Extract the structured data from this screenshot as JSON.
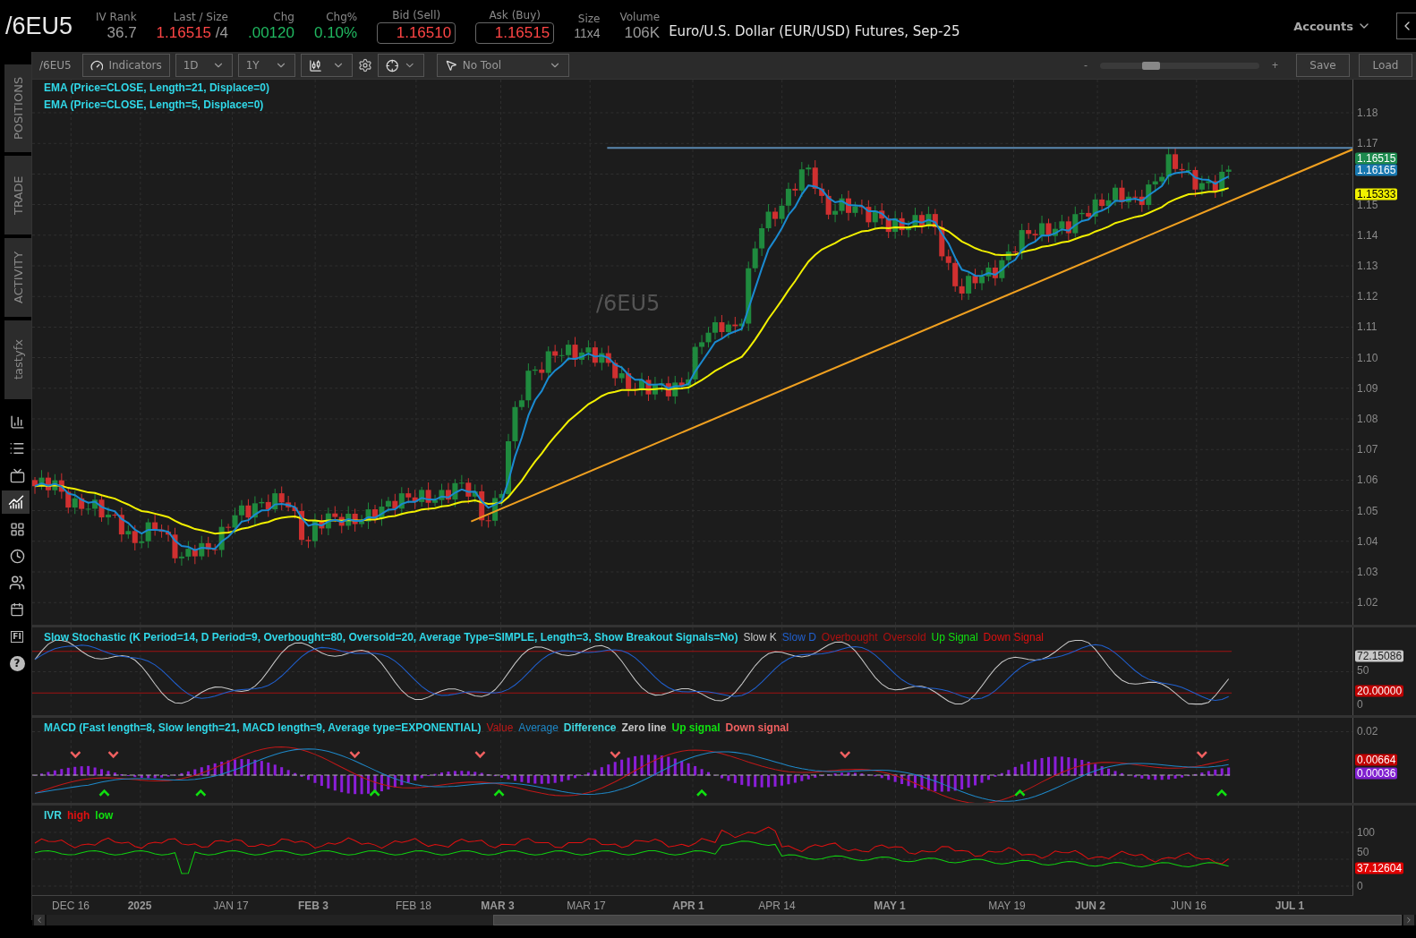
{
  "header": {
    "symbol": "/6EU5",
    "stats": [
      {
        "label": "IV Rank",
        "value": "36.7",
        "color": "#9a9a9a",
        "kind": "plain"
      },
      {
        "label": "Last / Size",
        "value": "1.16515",
        "extra": "/4",
        "color": "#ff4545",
        "kind": "plain"
      },
      {
        "label": "Chg",
        "value": ".00120",
        "color": "#20b860",
        "kind": "plain"
      },
      {
        "label": "Chg%",
        "value": "0.10%",
        "color": "#20b860",
        "kind": "plain"
      },
      {
        "label": "Bid (Sell)",
        "value": "1.16510",
        "color": "#ff4545",
        "kind": "boxed"
      },
      {
        "label": "Ask (Buy)",
        "value": "1.16515",
        "color": "#ff4545",
        "kind": "boxed"
      },
      {
        "label": "Size",
        "value": "11x4",
        "color": "#9a9a9a",
        "kind": "small"
      },
      {
        "label": "Volume",
        "value": "106K",
        "color": "#9a9a9a",
        "kind": "plain"
      }
    ],
    "description": "Euro/U.S. Dollar (EUR/USD) Futures, Sep-25",
    "accounts": "Accounts"
  },
  "sidebar": {
    "tabs": [
      "POSITIONS",
      "TRADE",
      "ACTIVITY",
      "tastyfx"
    ],
    "tools": [
      {
        "kind": "report",
        "selected": false
      },
      {
        "kind": "list",
        "selected": false
      },
      {
        "kind": "tv",
        "selected": false
      },
      {
        "kind": "chart",
        "selected": true
      },
      {
        "kind": "grid",
        "selected": false
      },
      {
        "kind": "clock",
        "selected": false
      },
      {
        "kind": "people",
        "selected": false
      },
      {
        "kind": "calendar",
        "selected": false
      },
      {
        "kind": "text",
        "label": "FI",
        "selected": false
      },
      {
        "kind": "help",
        "label": "?",
        "selected": false
      }
    ]
  },
  "toolbar": {
    "symbol": "/6EU5",
    "indicators": "Indicators",
    "aggregation": "1D",
    "range": "1Y",
    "drawing_tool": "No Tool",
    "zoom_out": "-",
    "zoom_in": "+",
    "zoom": {
      "level": 0.3
    },
    "save": "Save",
    "load": "Load"
  },
  "price_panel": {
    "studies": [
      "EMA (Price=CLOSE, Length=21, Displace=0)",
      "EMA (Price=CLOSE, Length=5, Displace=0)"
    ],
    "watermark": "/6EU5",
    "y_labels": [
      "1.18",
      "1.17",
      "1.15",
      "1.14",
      "1.13",
      "1.12",
      "1.11",
      "1.10",
      "1.09",
      "1.08",
      "1.07",
      "1.06",
      "1.05",
      "1.04",
      "1.03",
      "1.02"
    ],
    "badges": [
      {
        "value": "1.16515",
        "color": "#1d8a4e"
      },
      {
        "value": "1.16165",
        "color": "#1878b0"
      },
      {
        "value": "1.15333",
        "color": "#f0f000"
      }
    ]
  },
  "stochastic": {
    "title": "Slow Stochastic (K Period=14, D Period=9, Overbought=80, Oversold=20, Average Type=SIMPLE, Length=3, Show Breakout Signals=No)",
    "legend": [
      {
        "label": "Slow K",
        "color": "#c8c8c8"
      },
      {
        "label": "Slow D",
        "color": "#2060d0"
      },
      {
        "label": "Overbought",
        "color": "#b01010"
      },
      {
        "label": "Oversold",
        "color": "#b01010"
      },
      {
        "label": "Up Signal",
        "color": "#10e010"
      },
      {
        "label": "Down Signal",
        "color": "#e01010"
      }
    ],
    "y_labels": [
      "50",
      "0"
    ],
    "badges": [
      {
        "value": "72.15086",
        "color": "#c8c8c8"
      },
      {
        "value": "20.00000",
        "color": "#c00000"
      }
    ]
  },
  "macd": {
    "title": "MACD (Fast length=8, Slow length=21, MACD length=9, Average type=EXPONENTIAL)",
    "legend": [
      {
        "label": "Value",
        "color": "#c01818"
      },
      {
        "label": "Average",
        "color": "#1e88c8"
      },
      {
        "label": "Difference",
        "color": "#40d8e0"
      },
      {
        "label": "Zero line",
        "color": "#c8c8c8"
      },
      {
        "label": "Up signal",
        "color": "#10e010"
      },
      {
        "label": "Down signal",
        "color": "#f06060"
      }
    ],
    "y_labels": [
      "0.02"
    ],
    "badges": [
      {
        "value": "0.00664",
        "color": "#c00000"
      },
      {
        "value": "0.00036",
        "color": "#8020d0"
      }
    ]
  },
  "ivr": {
    "legend": [
      {
        "label": "IVR",
        "color": "#40d8e0"
      },
      {
        "label": "high",
        "color": "#e01010"
      },
      {
        "label": "low",
        "color": "#10e010"
      }
    ],
    "y_labels": [
      "100",
      "50",
      "0"
    ],
    "badges": [
      {
        "value": "37.12604",
        "color": "#e00000"
      }
    ]
  },
  "x_axis": [
    {
      "label": "DEC 16",
      "bold": false
    },
    {
      "label": "2025",
      "bold": true
    },
    {
      "label": "JAN 17",
      "bold": false
    },
    {
      "label": "FEB 3",
      "bold": true
    },
    {
      "label": "FEB 18",
      "bold": false
    },
    {
      "label": "MAR 3",
      "bold": true
    },
    {
      "label": "MAR 17",
      "bold": false
    },
    {
      "label": "APR 1",
      "bold": true
    },
    {
      "label": "APR 14",
      "bold": false
    },
    {
      "label": "MAY 1",
      "bold": true
    },
    {
      "label": "MAY 19",
      "bold": false
    },
    {
      "label": "JUN 2",
      "bold": true
    },
    {
      "label": "JUN 16",
      "bold": false
    },
    {
      "label": "JUL 1",
      "bold": true
    }
  ]
}
